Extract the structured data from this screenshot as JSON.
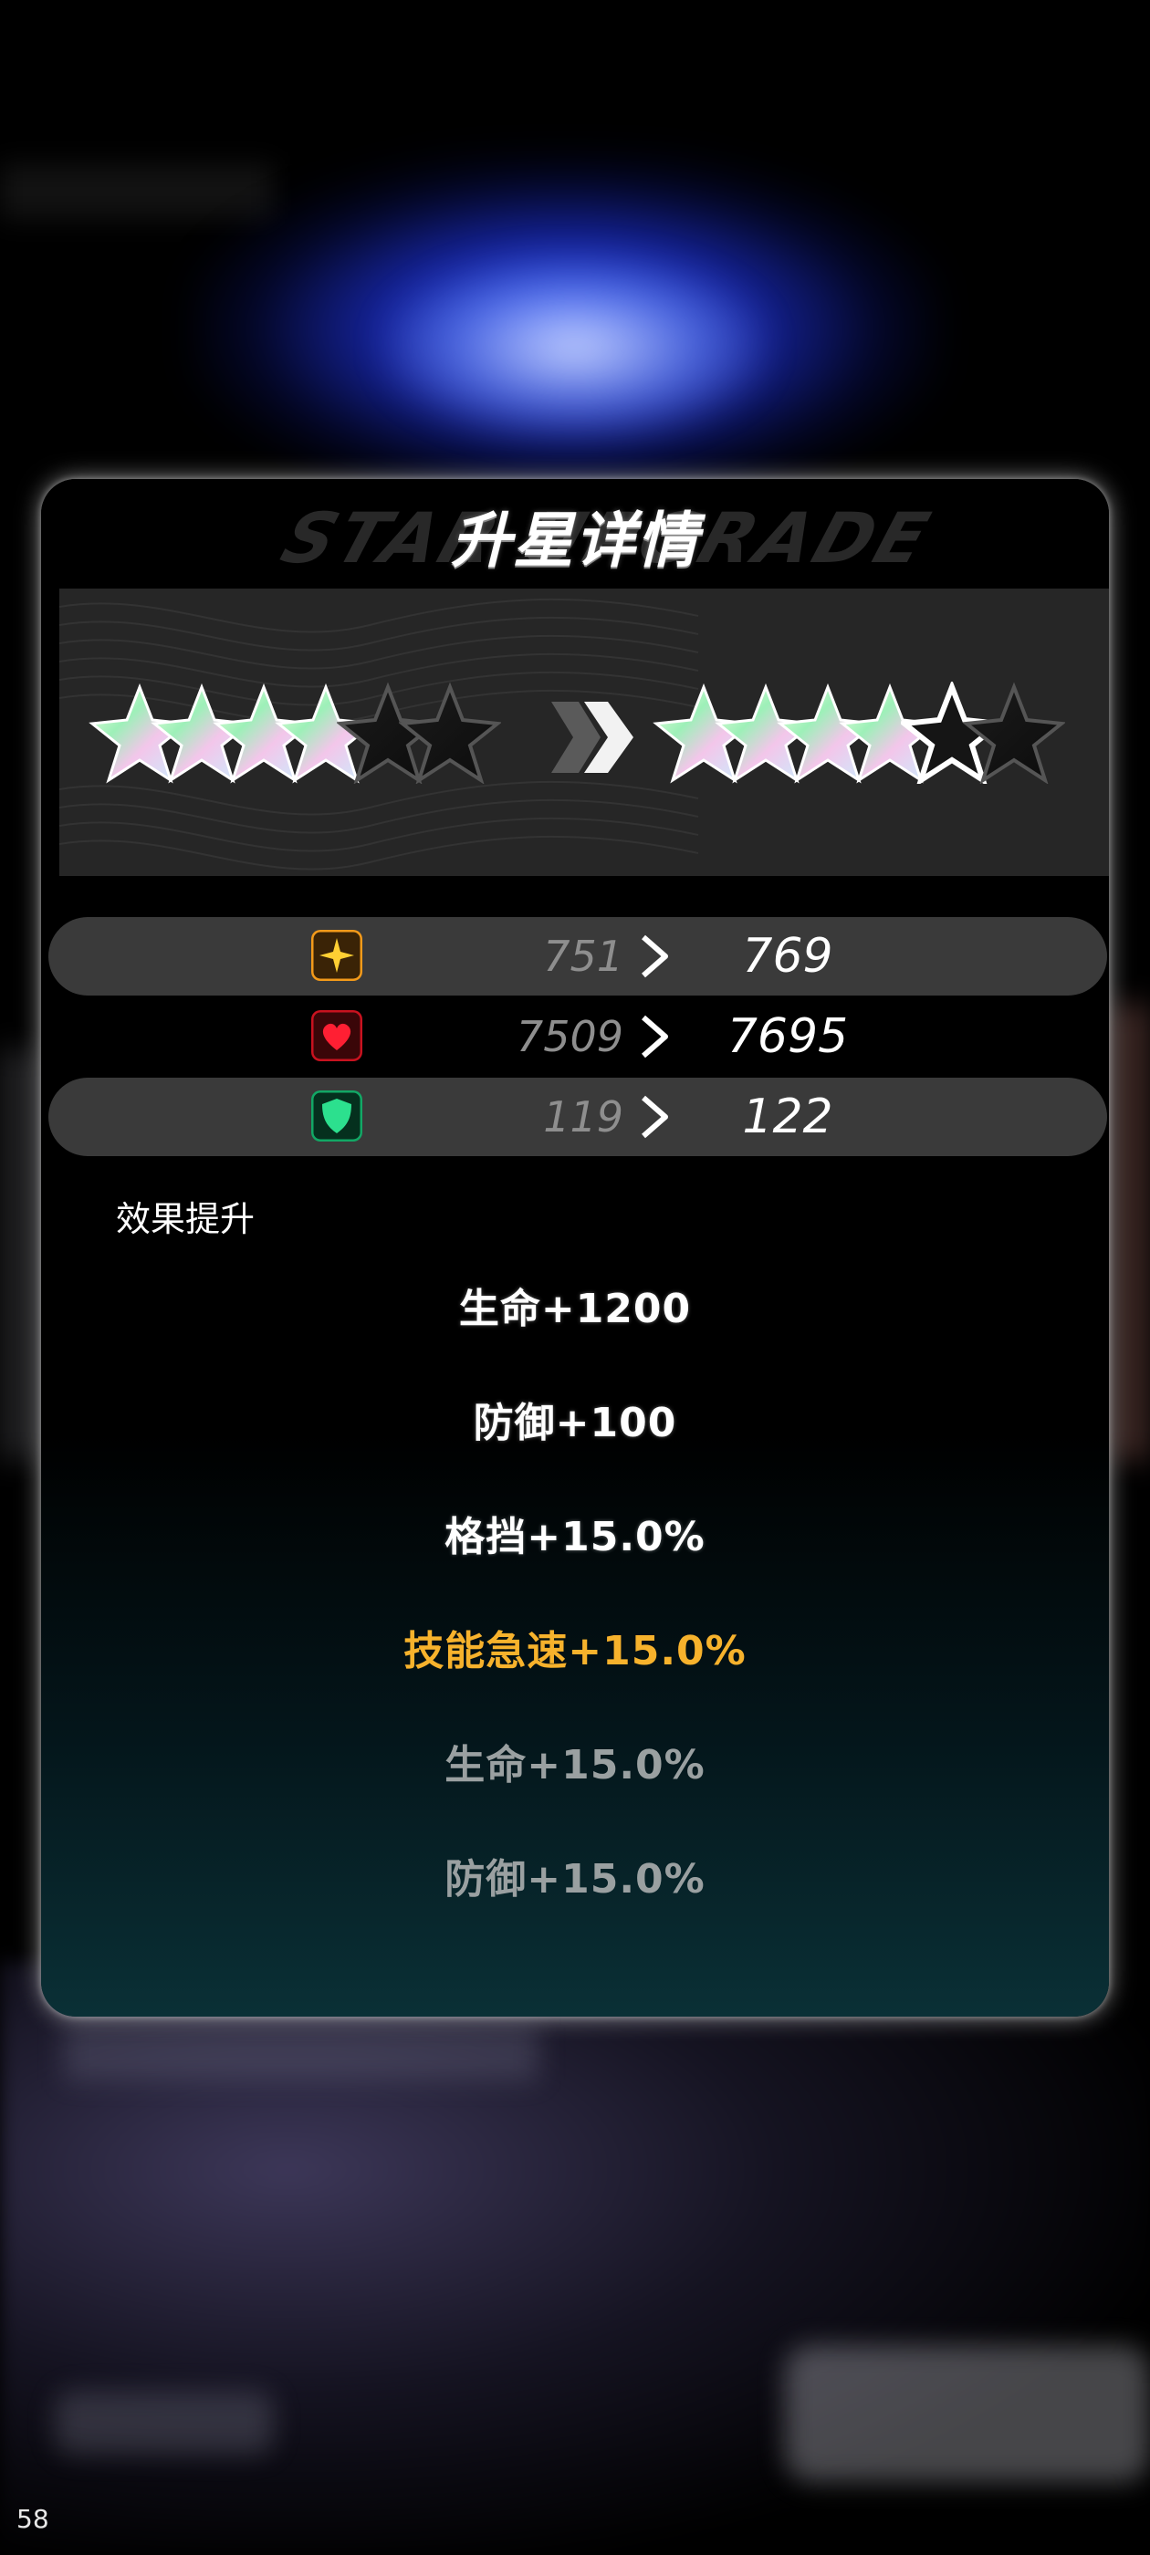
{
  "screen": {
    "corner_number": "58"
  },
  "panel": {
    "title": "升星详情",
    "title_watermark": "STAR UPGRADE",
    "stars": {
      "before": {
        "filled": 4,
        "total": 6
      },
      "after": {
        "filled": 4,
        "highlighted": 1,
        "total": 6
      }
    },
    "stats": [
      {
        "icon": "attack-star-icon",
        "old": "751",
        "new": "769",
        "icon_color": "#f6a21a"
      },
      {
        "icon": "health-heart-icon",
        "old": "7509",
        "new": "7695",
        "icon_color": "#e0192d"
      },
      {
        "icon": "defense-shield-icon",
        "old": "119",
        "new": "122",
        "icon_color": "#1fc27a"
      }
    ],
    "effects_label": "效果提升",
    "effects": [
      {
        "text": "生命+1200",
        "state": "achieved"
      },
      {
        "text": "防御+100",
        "state": "achieved"
      },
      {
        "text": "格挡+15.0%",
        "state": "achieved"
      },
      {
        "text": "技能急速+15.0%",
        "state": "new"
      },
      {
        "text": "生命+15.0%",
        "state": "locked"
      },
      {
        "text": "防御+15.0%",
        "state": "locked"
      }
    ]
  },
  "colors": {
    "effect_new": "#f7b22c",
    "effect_locked": "#9aa0a1",
    "panel_glow": "#ffffff"
  }
}
